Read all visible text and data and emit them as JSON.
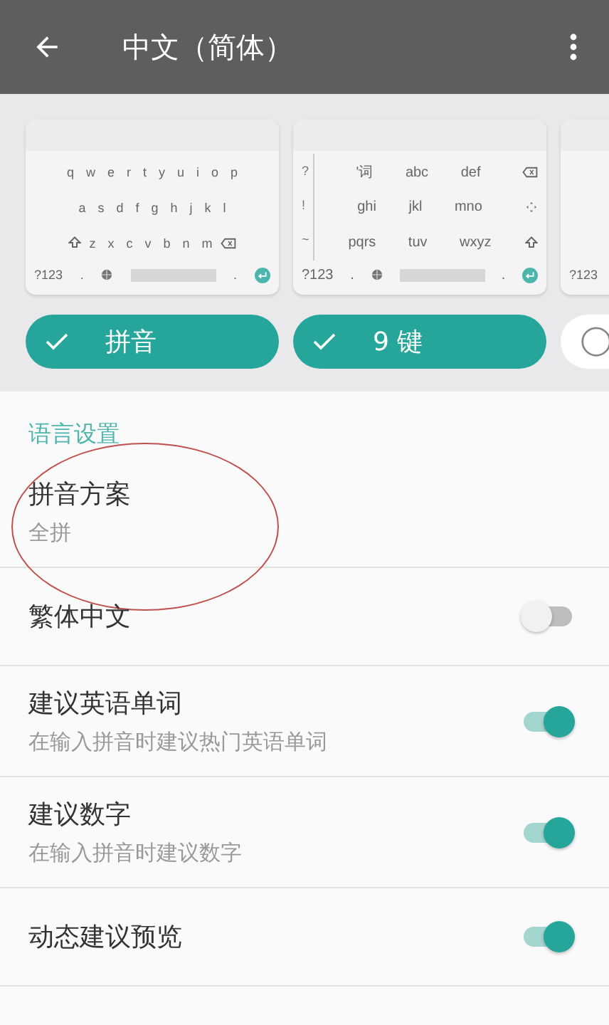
{
  "app_bar": {
    "title": "中文（简体）"
  },
  "keyboards": [
    {
      "kind": "qwerty",
      "rows": [
        "q w e r t y u i o p",
        "a s d f g h j k l",
        "z x c v b n m"
      ],
      "mode_key": "?123",
      "dot_key": "."
    },
    {
      "kind": "ninekey",
      "side": "? ! ~",
      "rows": [
        "'词 abc def",
        "ghi jkl mno",
        "pqrs tuv wxyz"
      ],
      "mode_key": "?123",
      "dot_key": "."
    },
    {
      "kind": "partial",
      "mode_key": "?123"
    }
  ],
  "layouts": [
    {
      "label": "拼音",
      "selected": true
    },
    {
      "label": "9 键",
      "selected": true
    },
    {
      "selected": false
    }
  ],
  "section": {
    "title": "语言设置"
  },
  "settings": [
    {
      "kind": "text",
      "title": "拼音方案",
      "summary": "全拼",
      "circled": true
    },
    {
      "kind": "switch",
      "title": "繁体中文",
      "on": false
    },
    {
      "kind": "switch",
      "title": "建议英语单词",
      "summary": "在输入拼音时建议热门英语单词",
      "on": true
    },
    {
      "kind": "switch",
      "title": "建议数字",
      "summary": "在输入拼音时建议数字",
      "on": true
    },
    {
      "kind": "switch",
      "title": "动态建议预览",
      "on": true
    }
  ]
}
